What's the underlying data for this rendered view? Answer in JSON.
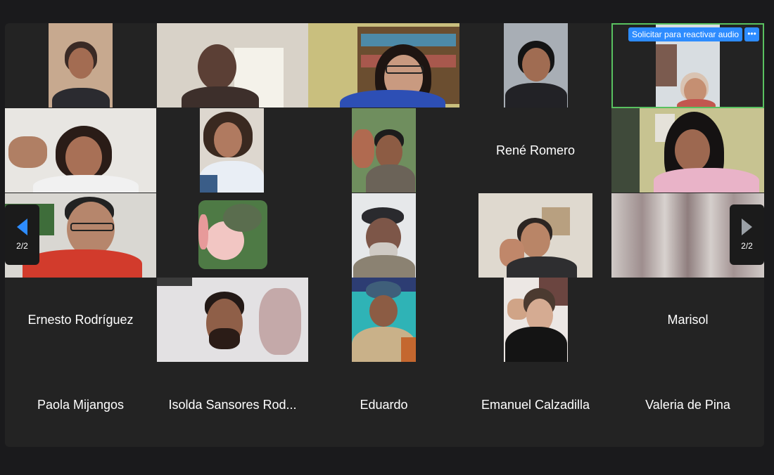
{
  "audio_request": {
    "label": "Solicitar para reactivar audio",
    "more": "•••"
  },
  "pagination": {
    "prev_label": "2/2",
    "next_label": "2/2"
  },
  "participants": [
    {
      "name": "René Romero"
    },
    {
      "name": "Ernesto Rodríguez"
    },
    {
      "name": "Marisol"
    },
    {
      "name": "Paola Mijangos"
    },
    {
      "name": "Isolda Sansores Rod..."
    },
    {
      "name": "Eduardo"
    },
    {
      "name": "Emanuel Calzadilla"
    },
    {
      "name": "Valeria de Pina"
    }
  ],
  "colors": {
    "accent": "#2d8cff",
    "active_speaker": "#59c160",
    "grid_bg": "#232323"
  }
}
